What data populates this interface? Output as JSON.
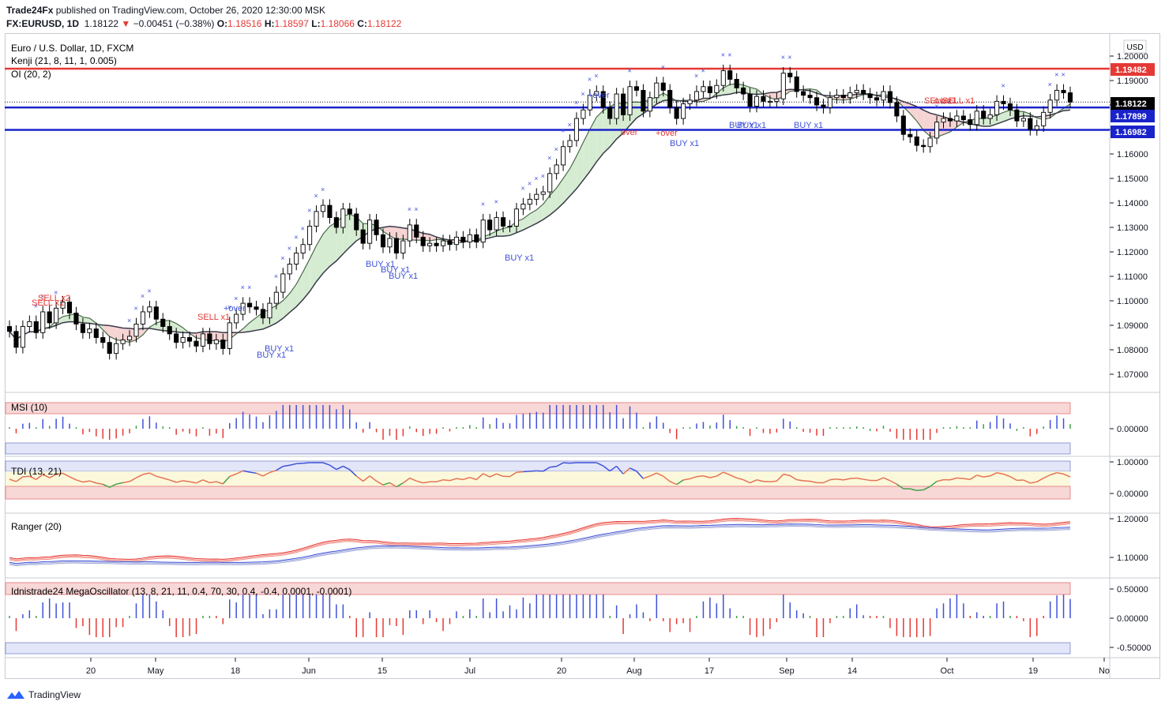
{
  "header": {
    "publisher": "Trade24Fx",
    "published_text": " published on TradingView.com, October 26, 2020 12:30:00 MSK",
    "symbol": "FX:EURUSD, 1D",
    "price": "1.18122",
    "change": "−0.00451 (−0.38%)",
    "o_label": "O:",
    "o_value": "1.18516",
    "h_label": "H:",
    "h_value": "1.18597",
    "l_label": "L:",
    "l_value": "1.18066",
    "c_label": "C:",
    "c_value": "1.18122"
  },
  "legend": {
    "title": "Euro / U.S. Dollar, 1D, FXCM",
    "kenji": "Kenji (21, 8, 11, 1, 0.005)",
    "oi": "OI (20, 2)",
    "msi": "MSI (10)",
    "tdi": "TDI (13, 21)",
    "ranger": "Ranger (20)",
    "mega": "Idnistrade24 MegaOscillator (13, 8, 21, 11, 0.4, 70, 30, 0.4, -0.4, 0.0001, -0.0001)"
  },
  "currency_label": "USD",
  "price_tags": [
    {
      "value": "1.19482",
      "color": "#e53935"
    },
    {
      "value": "1.18122",
      "color": "#000000"
    },
    {
      "value": "1.17899",
      "color": "#1a23c9"
    },
    {
      "value": "1.16982",
      "color": "#1a23c9"
    }
  ],
  "signals": [
    "SELL x2",
    "SELL x1",
    "SELL x1",
    "+over",
    "BUY x1",
    "BUY x1",
    "BUY x1",
    "BUY x1",
    "BUY x1",
    "BUY x1",
    "+over",
    "over",
    "+over",
    "BUY x1",
    "BUY x1",
    "BUY x1",
    "BUY x1",
    "SELL x1",
    "over",
    "SELL x1"
  ],
  "footer": {
    "brand": "TradingView"
  },
  "colors": {
    "bull": "#ffffff",
    "bear": "#000000",
    "red": "#e53935",
    "blue": "#1a23c9",
    "indicator_blue": "#3f51d8"
  },
  "chart_data": [
    {
      "type": "candlestick",
      "title": "Euro / U.S. Dollar, 1D, FXCM",
      "y_ticks": [
        "1.20000",
        "1.19000",
        "1.18000",
        "1.17000",
        "1.16000",
        "1.15000",
        "1.14000",
        "1.13000",
        "1.12000",
        "1.11000",
        "1.10000",
        "1.09000",
        "1.08000",
        "1.07000"
      ],
      "ylim": [
        1.065,
        1.202
      ],
      "x_ticks": [
        "20",
        "May",
        "18",
        "Jun",
        "15",
        "Jul",
        "20",
        "Aug",
        "17",
        "Sep",
        "14",
        "Oct",
        "19",
        "No"
      ],
      "horizontal_levels": [
        1.19482,
        1.17899,
        1.16982
      ],
      "last_close": 1.18122,
      "closes": [
        1.0875,
        1.081,
        1.0895,
        1.0915,
        1.087,
        1.0955,
        1.091,
        1.097,
        1.0995,
        1.095,
        1.0905,
        1.087,
        1.0885,
        1.085,
        1.083,
        1.0785,
        1.0825,
        1.084,
        1.0855,
        1.0905,
        1.0955,
        1.0975,
        1.0925,
        1.0895,
        1.0865,
        1.083,
        1.085,
        1.0835,
        1.0815,
        1.0865,
        1.0825,
        1.084,
        1.0805,
        1.091,
        1.0945,
        1.099,
        1.0975,
        1.0965,
        1.093,
        1.099,
        1.1035,
        1.111,
        1.115,
        1.1195,
        1.123,
        1.1305,
        1.1365,
        1.139,
        1.134,
        1.13,
        1.1375,
        1.1355,
        1.129,
        1.1235,
        1.133,
        1.127,
        1.122,
        1.1255,
        1.1195,
        1.1245,
        1.131,
        1.126,
        1.1225,
        1.1235,
        1.1225,
        1.1245,
        1.123,
        1.126,
        1.124,
        1.127,
        1.124,
        1.133,
        1.129,
        1.134,
        1.1305,
        1.1305,
        1.1375,
        1.1395,
        1.1415,
        1.1435,
        1.1445,
        1.152,
        1.1555,
        1.163,
        1.1655,
        1.1745,
        1.178,
        1.184,
        1.1855,
        1.179,
        1.1745,
        1.1845,
        1.176,
        1.1875,
        1.186,
        1.1775,
        1.183,
        1.189,
        1.186,
        1.179,
        1.1745,
        1.1805,
        1.182,
        1.1855,
        1.1875,
        1.185,
        1.188,
        1.194,
        1.1905,
        1.187,
        1.1845,
        1.1795,
        1.1835,
        1.1815,
        1.1815,
        1.1825,
        1.193,
        1.1915,
        1.1855,
        1.184,
        1.183,
        1.18,
        1.179,
        1.183,
        1.184,
        1.183,
        1.185,
        1.186,
        1.1845,
        1.183,
        1.182,
        1.1855,
        1.181,
        1.1755,
        1.168,
        1.167,
        1.1635,
        1.163,
        1.1665,
        1.173,
        1.1745,
        1.1735,
        1.1755,
        1.174,
        1.172,
        1.1775,
        1.1745,
        1.176,
        1.1815,
        1.1805,
        1.178,
        1.1735,
        1.1745,
        1.17,
        1.1715,
        1.177,
        1.182,
        1.186,
        1.185,
        1.1812
      ],
      "panes": [
        "price",
        "MSI (10)",
        "TDI (13, 21)",
        "Ranger (20)",
        "Idnistrade24 MegaOscillator"
      ]
    },
    {
      "type": "bar",
      "title": "MSI (10)",
      "y_ticks": [
        "0.00000"
      ]
    },
    {
      "type": "line",
      "title": "TDI (13, 21)",
      "y_ticks": [
        "1.00000",
        "0.00000"
      ]
    },
    {
      "type": "line",
      "title": "Ranger (20)",
      "y_ticks": [
        "1.20000",
        "1.10000"
      ]
    },
    {
      "type": "bar",
      "title": "Idnistrade24 MegaOscillator",
      "y_ticks": [
        "0.50000",
        "0.00000",
        "-0.50000"
      ]
    }
  ]
}
